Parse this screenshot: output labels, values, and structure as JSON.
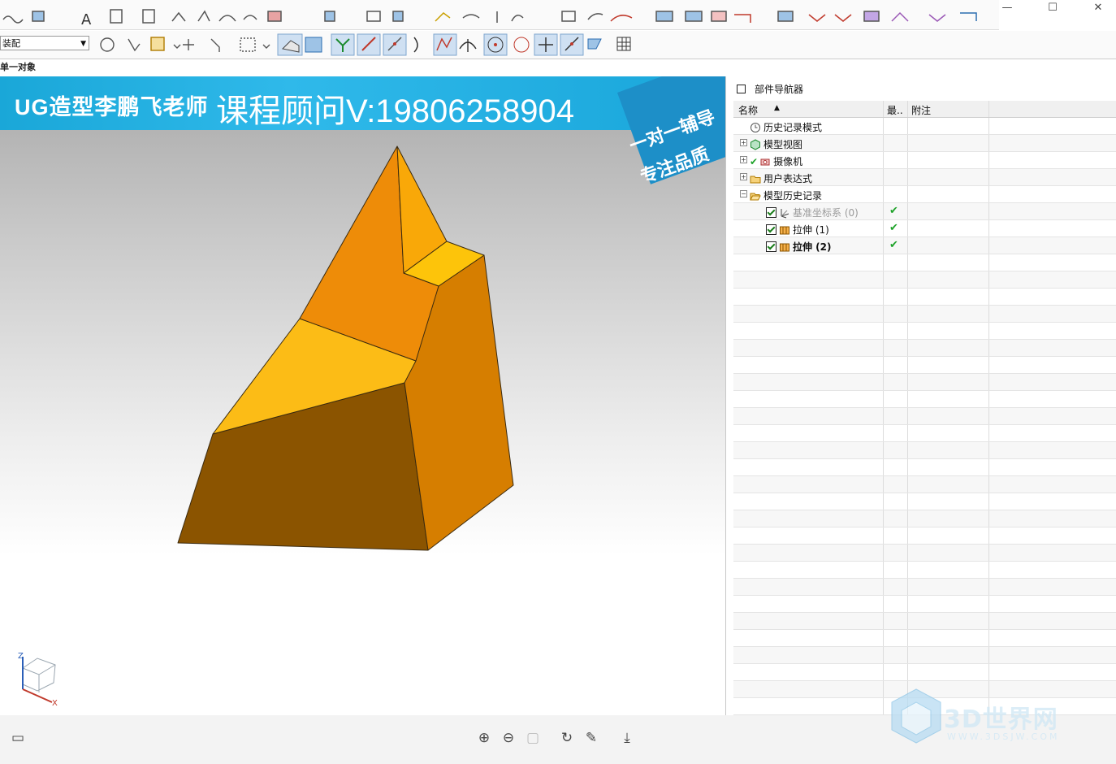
{
  "toolbar": {
    "assembly_select": "装配",
    "status_text": "单一对象"
  },
  "window": {
    "minimize": "—",
    "maximize": "☐",
    "close": "✕"
  },
  "banner": {
    "left_text": "UG造型李鹏飞老师",
    "right_text": "课程顾问V:19806258904",
    "ribbon_line1": "一对一辅导",
    "ribbon_line2": "专注品质"
  },
  "navigator": {
    "title": "部件导航器",
    "columns": [
      "名称",
      "最..",
      "附注"
    ],
    "nodes": [
      {
        "label": "历史记录模式",
        "icon": "clock-icon",
        "level": 0,
        "expander": "",
        "check": false,
        "state": ""
      },
      {
        "label": "模型视图",
        "icon": "model-view-icon",
        "level": 0,
        "expander": "+",
        "check": false,
        "state": ""
      },
      {
        "label": "摄像机",
        "icon": "camera-icon",
        "level": 0,
        "expander": "+",
        "check": false,
        "state": ""
      },
      {
        "label": "用户表达式",
        "icon": "folder-icon",
        "level": 0,
        "expander": "+",
        "check": false,
        "state": ""
      },
      {
        "label": "模型历史记录",
        "icon": "folder-open-icon",
        "level": 0,
        "expander": "−",
        "check": false,
        "state": ""
      },
      {
        "label": "基准坐标系 (0)",
        "icon": "datum-csys-icon",
        "level": 1,
        "expander": "",
        "check": true,
        "state": "✔"
      },
      {
        "label": "拉伸 (1)",
        "icon": "extrude-icon",
        "level": 1,
        "expander": "",
        "check": true,
        "state": "✔"
      },
      {
        "label": "拉伸 (2)",
        "icon": "extrude-icon",
        "level": 1,
        "expander": "",
        "check": true,
        "state": "✔"
      }
    ]
  },
  "triad": {
    "z": "Z",
    "x": "X"
  },
  "watermark": {
    "text": "3D世界网",
    "url": "WWW.3DSJW.COM"
  },
  "colors": {
    "banner_blue": "#1aa7d8",
    "model_light": "#fcbc16",
    "model_mid": "#ee8c08",
    "model_dark": "#8b5400",
    "check_green": "#1fa32a"
  }
}
